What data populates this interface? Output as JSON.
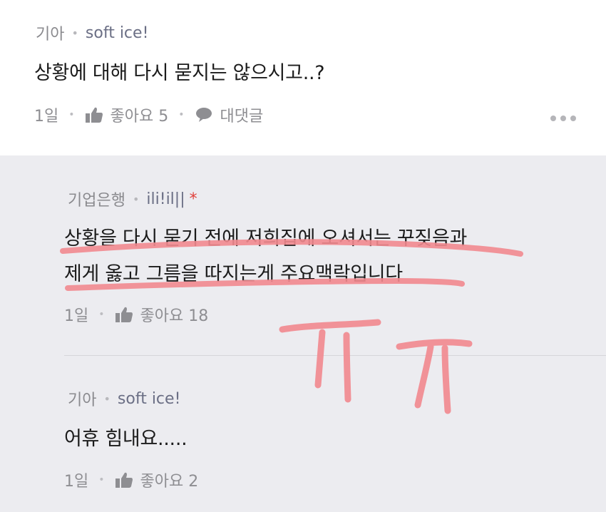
{
  "comments": [
    {
      "company": "기아",
      "nickname": "soft ice!",
      "text": "상황에 대해 다시 묻지는 않으시고..?",
      "time": "1일",
      "like_label": "좋아요 5",
      "reply_label": "대댓글"
    }
  ],
  "replies": [
    {
      "company": "기업은행",
      "nickname": "ili!il||",
      "author_mark": "*",
      "text_line1": "상황을 다시 묻기 전에 저희집에 오셔서는 꾸짖음과",
      "text_line2": "제게 옳고 그름을 따지는게 주요맥락입니다",
      "time": "1일",
      "like_label": "좋아요 18"
    },
    {
      "company": "기아",
      "nickname": "soft ice!",
      "text": "어휴 힘내요.....",
      "time": "1일",
      "like_label": "좋아요 2"
    }
  ],
  "icons": {
    "like": "thumbs-up-icon",
    "reply": "speech-bubble-icon",
    "more": "more-dots-icon"
  },
  "colors": {
    "annotation_pink": "#f2898f",
    "background_gray": "#ececf0",
    "meta_gray": "#8a8a8e",
    "author_star": "#e0403a"
  }
}
